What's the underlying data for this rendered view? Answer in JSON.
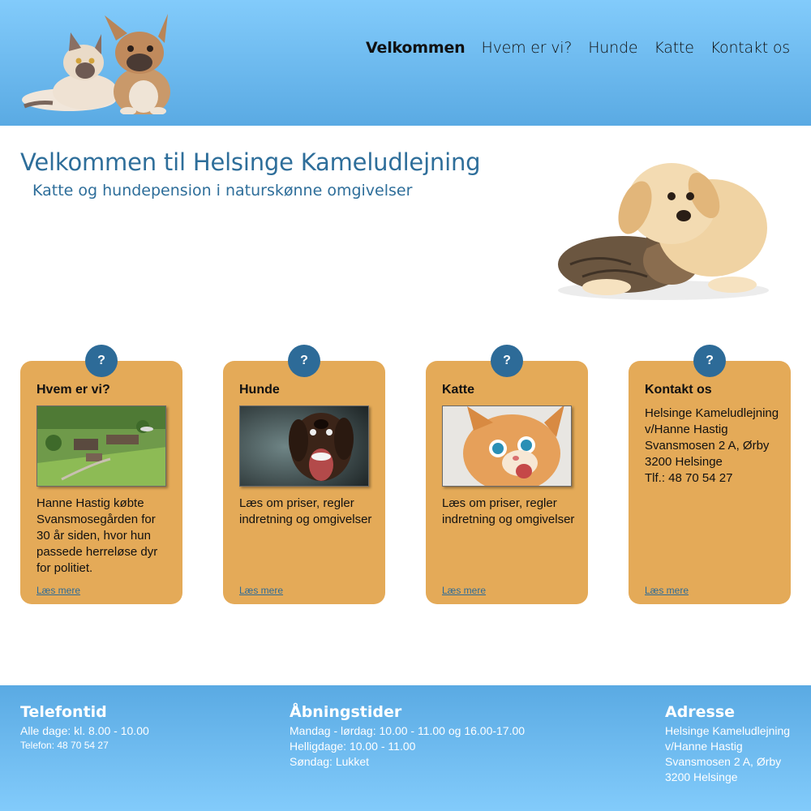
{
  "nav": {
    "items": [
      "Velkommen",
      "Hvem er vi?",
      "Hunde",
      "Katte",
      "Kontakt os"
    ],
    "active": "Velkommen"
  },
  "hero": {
    "title": "Velkommen til Helsinge Kameludlejning",
    "subtitle": "Katte og hundepension i naturskønne omgivelser"
  },
  "cards": [
    {
      "badge": "?",
      "title": "Hvem er vi?",
      "text": "Hanne Hastig købte Svansmosegården for 30 år siden, hvor hun passede herreløse dyr for politiet.",
      "link": "Læs mere"
    },
    {
      "badge": "?",
      "title": "Hunde",
      "text": "Læs om priser, regler indretning og omgivelser",
      "link": "Læs mere"
    },
    {
      "badge": "?",
      "title": "Katte",
      "text": "Læs om priser, regler indretning og omgivelser",
      "link": "Læs mere"
    },
    {
      "badge": "?",
      "title": "Kontakt os",
      "lines": [
        "Helsinge Kameludlejning",
        "v/Hanne Hastig",
        "Svansmosen 2 A, Ørby",
        "3200 Helsinge",
        "Tlf.: 48 70 54 27"
      ],
      "link": "Læs mere"
    }
  ],
  "footer": {
    "phone": {
      "title": "Telefontid",
      "line1": "Alle dage: kl. 8.00 - 10.00",
      "line2": "Telefon: 48 70 54 27"
    },
    "hours": {
      "title": "Åbningstider",
      "lines": [
        "Mandag - lørdag: 10.00 - 11.00 og 16.00-17.00",
        "Helligdage: 10.00 - 11.00",
        "Søndag: Lukket"
      ]
    },
    "address": {
      "title": "Adresse",
      "lines": [
        "Helsinge Kameludlejning",
        "v/Hanne Hastig",
        "Svansmosen 2 A, Ørby",
        "3200 Helsinge"
      ]
    }
  },
  "colors": {
    "header_top": "#82cbfb",
    "header_bottom": "#5aaae3",
    "heading_blue": "#2e6e9a",
    "card_bg": "#e4aa58",
    "badge_bg": "#2d6b98"
  }
}
